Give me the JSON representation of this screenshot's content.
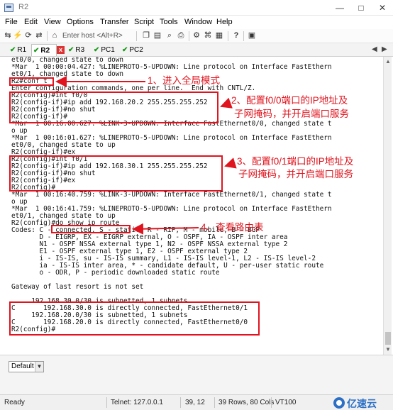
{
  "window": {
    "title": "R2",
    "min_glyph": "—",
    "max_glyph": "□",
    "close_glyph": "✕"
  },
  "menu": [
    "File",
    "Edit",
    "View",
    "Options",
    "Transfer",
    "Script",
    "Tools",
    "Window",
    "Help"
  ],
  "toolbar": {
    "host_placeholder": "Enter host <Alt+R>",
    "icons": [
      "connect-icon",
      "lightning-icon",
      "reconnect-icon",
      "disconnect-icon",
      "copy-icon",
      "paste-icon",
      "find-icon",
      "print-icon",
      "settings-icon",
      "keymap-icon",
      "sftp-icon",
      "help-icon",
      "map-icon"
    ]
  },
  "tabs": [
    {
      "label": "R1",
      "active": false
    },
    {
      "label": "R2",
      "active": true
    },
    {
      "label": "R3",
      "active": false
    },
    {
      "label": "PC1",
      "active": false
    },
    {
      "label": "PC2",
      "active": false
    }
  ],
  "tab_close_glyph": "x",
  "tab_nav": {
    "prev": "◀",
    "next": "▶"
  },
  "terminal_lines": [
    "et0/0, changed state to down",
    "*Mar  1 00:00:04.427: %LINEPROTO-5-UPDOWN: Line protocol on Interface FastEthern",
    "et0/1, changed state to down",
    "R2#conf t",
    "Enter configuration commands, one per line.  End with CNTL/Z.",
    "R2(config)#int f0/0",
    "R2(config-if)#ip add 192.168.20.2 255.255.255.252",
    "R2(config-if)#no shut",
    "R2(config-if)#",
    "*Mar  1 00:16:00.627: %LINK-3-UPDOWN: Interface FastEthernet0/0, changed state t",
    "o up",
    "*Mar  1 00:16:01.627: %LINEPROTO-5-UPDOWN: Line protocol on Interface FastEthern",
    "et0/0, changed state to up",
    "R2(config-if)#ex",
    "R2(config)#int f0/1",
    "R2(config-if)#ip add 192.168.30.1 255.255.255.252",
    "R2(config-if)#no shut",
    "R2(config-if)#ex",
    "R2(config)#",
    "*Mar  1 00:16:40.759: %LINK-3-UPDOWN: Interface FastEthernet0/1, changed state t",
    "o up",
    "*Mar  1 00:16:41.759: %LINEPROTO-5-UPDOWN: Line protocol on Interface FastEthern",
    "et0/1, changed state to up",
    "R2(config)#do show ip route",
    "Codes: C - connected, S - static, R - RIP, M - mobile, B - BGP",
    "       D - EIGRP, EX - EIGRP external, O - OSPF, IA - OSPF inter area",
    "       N1 - OSPF NSSA external type 1, N2 - OSPF NSSA external type 2",
    "       E1 - OSPF external type 1, E2 - OSPF external type 2",
    "       i - IS-IS, su - IS-IS summary, L1 - IS-IS level-1, L2 - IS-IS level-2",
    "       ia - IS-IS inter area, * - candidate default, U - per-user static route",
    "       o - ODR, P - periodic downloaded static route",
    "",
    "Gateway of last resort is not set",
    "",
    "     192.168.30.0/30 is subnetted, 1 subnets",
    "C       192.168.30.0 is directly connected, FastEthernet0/1",
    "     192.168.20.0/30 is subnetted, 1 subnets",
    "C       192.168.20.0 is directly connected, FastEthernet0/0",
    "R2(config)#"
  ],
  "annotations": {
    "a1": "1、进入全局模式",
    "a2_1": "2、配置f0/0端口的IP地址及",
    "a2_2": "子网掩码，并开启端口服务",
    "a3_1": "3、配置f0/1端口的IP地址及",
    "a3_2": "子网掩码，并开启端口服务",
    "a4": "4、查看路由表"
  },
  "bottom": {
    "session_select": "Default"
  },
  "status": {
    "ready": "Ready",
    "telnet": "Telnet: 127.0.0.1",
    "cursor": "39, 12",
    "size": "39 Rows, 80 Cols",
    "term": "VT100"
  },
  "watermark": "亿速云",
  "colors": {
    "highlight": "#e0141e",
    "check": "#1a9a1a",
    "watermark": "#2c6fc5"
  }
}
